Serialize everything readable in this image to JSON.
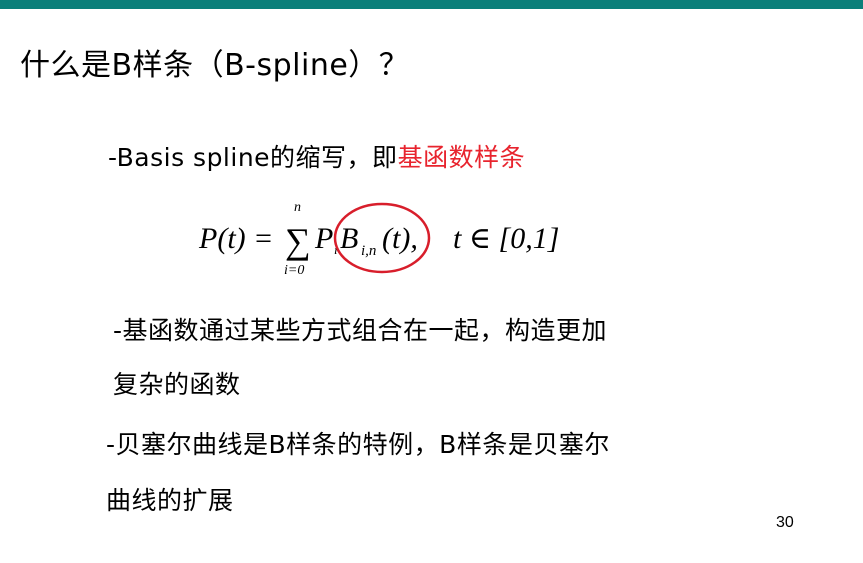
{
  "slide": {
    "title": "什么是B样条（B-spline）？",
    "bullet1": {
      "prefix": "-Basis spline的缩写，即",
      "highlight": "基函数样条",
      "highlight_color": "#e8242e"
    },
    "formula": {
      "lhs": "P(t) = ",
      "sum_upper": "n",
      "sum_lower": "i=0",
      "sum_symbol": "∑",
      "term_P": "P",
      "term_P_sub": "i",
      "basis": "B",
      "basis_sub": "i,n",
      "basis_arg": "(t),",
      "domain": "t ∈ [0,1]",
      "circle_color": "#d81e2b"
    },
    "bullet2": {
      "line1": "-基函数通过某些方式组合在一起，构造更加",
      "line2": "复杂的函数"
    },
    "bullet3": {
      "line1": "-贝塞尔曲线是B样条的特例，B样条是贝塞尔",
      "line2": "曲线的扩展"
    },
    "page_number": "30",
    "accent_color": "#0b7f7a"
  }
}
